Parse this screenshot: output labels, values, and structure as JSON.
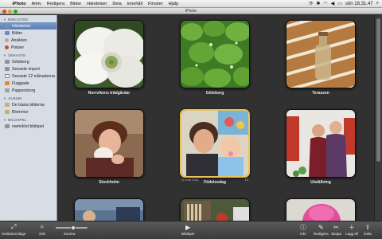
{
  "menubar": {
    "items": [
      "iPhoto",
      "Arkiv",
      "Redigera",
      "Bilder",
      "Händelser",
      "Dela",
      "Innehåll",
      "Fönster",
      "Hjälp"
    ],
    "clock": "sön 18.31.47"
  },
  "window": {
    "title": "iPhoto"
  },
  "sidebar": {
    "sections": [
      {
        "title": "BIBLIOTEK",
        "items": [
          {
            "label": "Händelser",
            "icon": "events-icon",
            "selected": true
          },
          {
            "label": "Bilder",
            "icon": "photos-icon"
          },
          {
            "label": "Ansikten",
            "icon": "faces-icon"
          },
          {
            "label": "Platser",
            "icon": "places-icon"
          }
        ]
      },
      {
        "title": "SENASTE",
        "items": [
          {
            "label": "Göteborg",
            "icon": "event-icon"
          },
          {
            "label": "Senaste import",
            "icon": "import-icon"
          },
          {
            "label": "Senaste 12 månaderna",
            "icon": "calendar-icon"
          },
          {
            "label": "Flaggade",
            "icon": "flag-icon"
          },
          {
            "label": "Papperskorg",
            "icon": "trash-icon"
          }
        ]
      },
      {
        "title": "ALBUM",
        "items": [
          {
            "label": "De bästa bilderna",
            "icon": "album-icon"
          },
          {
            "label": "Blommor",
            "icon": "album-icon"
          }
        ]
      },
      {
        "title": "BILDSPEL",
        "items": [
          {
            "label": "namnlöst bildspel",
            "icon": "slideshow-icon"
          }
        ]
      }
    ]
  },
  "events": [
    {
      "label": "Norrvikens trädgårdar"
    },
    {
      "label": "Göteborg"
    },
    {
      "label": "Terassen"
    },
    {
      "label": "Stockholm"
    },
    {
      "label": "Födelsedag",
      "date": "11 mar 2011",
      "count": "13",
      "highlighted": true
    },
    {
      "label": "Utställning"
    },
    {
      "label": ""
    },
    {
      "label": ""
    },
    {
      "label": ""
    }
  ],
  "toolbar": {
    "fullscreen": "Helskärmsläge",
    "search": "Sök",
    "zoom": "Zooma",
    "zoom_level": 0.55,
    "slideshow": "Bildspel",
    "info": "Info",
    "edit": "Redigera",
    "create": "Skapa",
    "add_to": "Lägg till",
    "share": "Dela"
  }
}
